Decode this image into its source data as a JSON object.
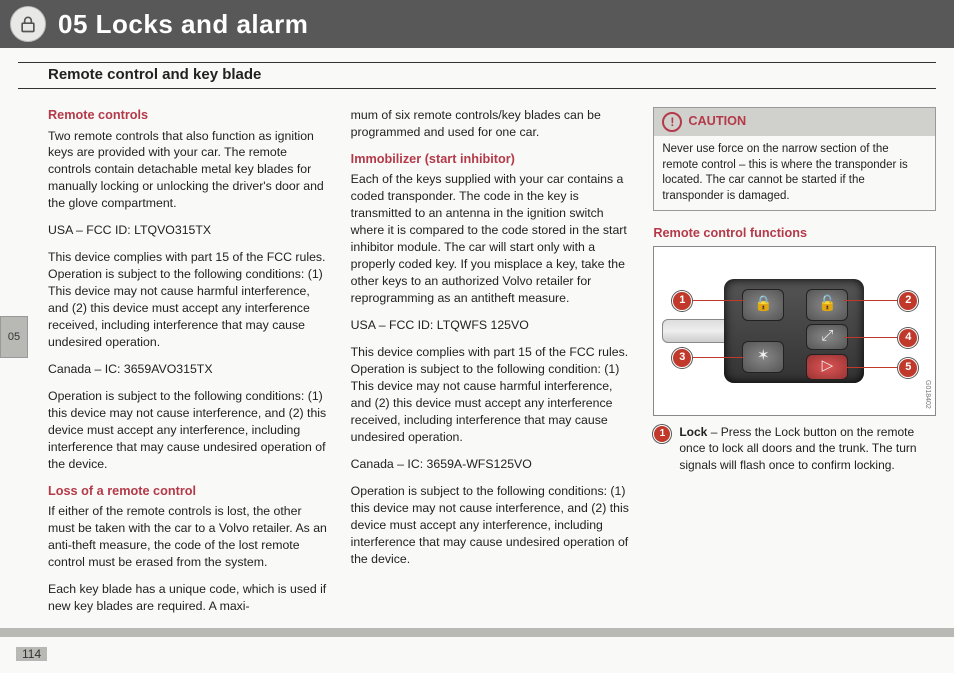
{
  "header": {
    "chapter_label": "05 Locks and alarm",
    "section_title": "Remote control and key blade"
  },
  "side_tab": "05",
  "page_number": "114",
  "col1": {
    "remote_controls": {
      "title": "Remote controls",
      "p1": "Two remote controls that also function as ignition keys are provided with your car. The remote controls contain detachable metal key blades for manually locking or unlocking the driver's door and the glove compartment.",
      "usa_id": "USA – FCC ID: LTQVO315TX",
      "fcc": "This device complies with part 15 of the FCC rules. Operation is subject to the following conditions: (1) This device may not cause harmful interference, and (2) this device must accept any interference received, including interference that may cause undesired operation.",
      "canada_id": "Canada – IC: 3659AVO315TX",
      "ic": "Operation is subject to the following conditions: (1) this device may not cause interference, and (2) this device must accept any interference, including interference that may cause undesired operation of the device."
    },
    "loss": {
      "title": "Loss of a remote control",
      "p1": "If either of the remote controls is lost, the other must be taken with the car to a Volvo retailer. As an anti-theft measure, the code of the lost remote control must be erased from the system.",
      "p2": "Each key blade has a unique code, which is used if new key blades are required. A maxi-"
    }
  },
  "col2": {
    "cont": "mum of six remote controls/key blades can be programmed and used for one car.",
    "immob": {
      "title": "Immobilizer (start inhibitor)",
      "p1": "Each of the keys supplied with your car contains a coded transponder. The code in the key is transmitted to an antenna in the ignition switch where it is compared to the code stored in the start inhibitor module. The car will start only with a properly coded key. If you misplace a key, take the other keys to an authorized Volvo retailer for reprogramming as an antitheft measure.",
      "usa_id": "USA – FCC ID: LTQWFS 125VO",
      "fcc": "This device complies with part 15 of the FCC rules. Operation is subject to the following condition: (1) This device may not cause harmful interference, and (2) this device must accept any interference received, including interference that may cause undesired operation.",
      "canada_id": "Canada – IC: 3659A-WFS125VO",
      "ic": "Operation is subject to the following conditions: (1) this device may not cause interference, and (2) this device must accept any interference, including interference that may cause undesired operation of the device."
    }
  },
  "col3": {
    "caution": {
      "title": "CAUTION",
      "body": "Never use force on the narrow section of the remote control – this is where the transponder is located. The car cannot be started if the transponder is damaged."
    },
    "functions": {
      "title": "Remote control functions",
      "labels": {
        "n1": "1",
        "n2": "2",
        "n3": "3",
        "n4": "4",
        "n5": "5"
      },
      "illus_id": "G018402",
      "lock_item_num": "1",
      "lock_item_label": "Lock",
      "lock_item_text": " – Press the Lock button on the remote once to lock all doors and the trunk. The turn signals will flash once to confirm locking."
    }
  }
}
